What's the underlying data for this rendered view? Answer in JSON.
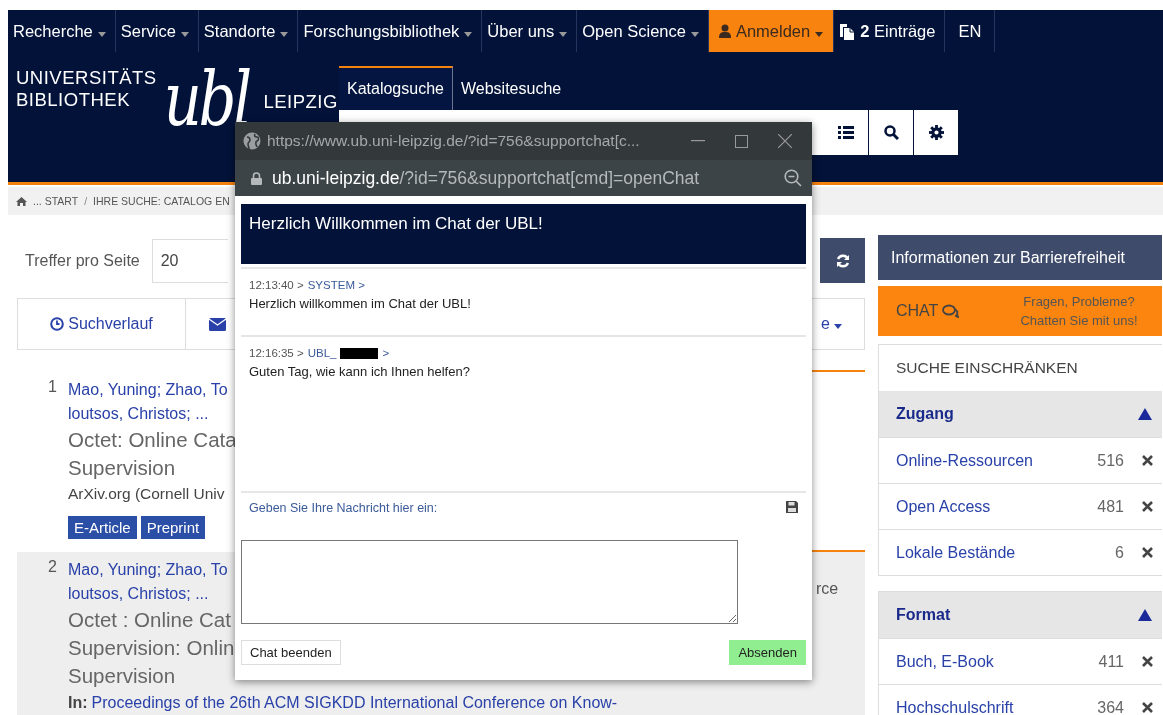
{
  "nav": [
    {
      "label": "Recherche",
      "kind": "menu"
    },
    {
      "label": "Service",
      "kind": "menu"
    },
    {
      "label": "Standorte",
      "kind": "menu"
    },
    {
      "label": "Forschungsbibliothek",
      "kind": "menu"
    },
    {
      "label": "Über uns",
      "kind": "menu"
    },
    {
      "label": "Open Science",
      "kind": "menu"
    },
    {
      "label": "Anmelden",
      "kind": "login"
    },
    {
      "label": "**2** Einträge",
      "kind": "cart"
    },
    {
      "label": "EN",
      "kind": "language"
    }
  ],
  "logo": {
    "line_1": "UNIVERSITÄTS",
    "line_2": "BIBLIOTHEK",
    "mark": "ubl",
    "city": "LEIPZIG"
  },
  "search_tabs": [
    {
      "label": "Katalogsuche",
      "selected": true
    },
    {
      "label": "Websitesuche",
      "selected": false
    }
  ],
  "breadcrumb": [
    "... START",
    "/",
    "IHRE SUCHE: CATALOG EN"
  ],
  "per_page": {
    "label": "Treffer pro Seite",
    "value": "20"
  },
  "toolbar": {
    "history": "Suchverlauf",
    "fragment": "e"
  },
  "results": [
    {
      "number": "1",
      "authors": [
        "Mao, Yuning; Zhao, To",
        "loutsos, Christos; ..."
      ],
      "title": [
        "Octet: Online Cata",
        "Supervision"
      ],
      "source": "ArXiv.org (Cornell Univ",
      "tags": [
        "E-Article",
        "Preprint"
      ],
      "highlighted": false
    },
    {
      "number": "2",
      "authors": [
        "Mao, Yuning; Zhao, To",
        "loutsos, Christos; ..."
      ],
      "title": [
        "Octet : Online Cat",
        "Supervision: Onlin",
        "Supervision"
      ],
      "side_fragment": "rce",
      "in_label": "In:",
      "in_link": "Proceedings of the 26th ACM SIGKDD International Conference on Know-",
      "highlighted": true
    }
  ],
  "sidebar": {
    "accessibility": "Informationen zur Barrierefreiheit",
    "chat": {
      "label": "CHAT",
      "line_1": "Fragen, Probleme?",
      "line_2": "Chatten Sie mit uns!"
    },
    "refine_title": "SUCHE EINSCHRÄNKEN",
    "facets": [
      {
        "title": "Zugang",
        "expanded": true,
        "items": [
          {
            "label": "Online-Ressourcen",
            "count": "516"
          },
          {
            "label": "Open Access",
            "count": "481"
          },
          {
            "label": "Lokale Bestände",
            "count": "6"
          }
        ]
      },
      {
        "title": "Format",
        "expanded": true,
        "items": [
          {
            "label": "Buch, E-Book",
            "count": "411"
          },
          {
            "label": "Hochschulschrift",
            "count": "364"
          }
        ]
      }
    ]
  },
  "popup": {
    "title": "https://www.ub.uni-leipzig.de/?id=756&supportchat[c...",
    "domain": "ub.uni-leipzig.de",
    "path": "/?id=756&supportchat[cmd]=openChat",
    "heading": "Herzlich Willkommen im Chat der UBL!",
    "messages": [
      {
        "time": "12:13:40 >",
        "sender": "SYSTEM >",
        "redacted": false,
        "text": "Herzlich willkommen im Chat der UBL!"
      },
      {
        "time": "12:16:35 >",
        "sender": "UBL_",
        "redacted": true,
        "sender_tail": ">",
        "text": "Guten Tag, wie kann ich Ihnen helfen?"
      }
    ],
    "prompt": "Geben Sie Ihre Nachricht hier ein:",
    "end_button": "Chat beenden",
    "send_button": "Absenden"
  }
}
